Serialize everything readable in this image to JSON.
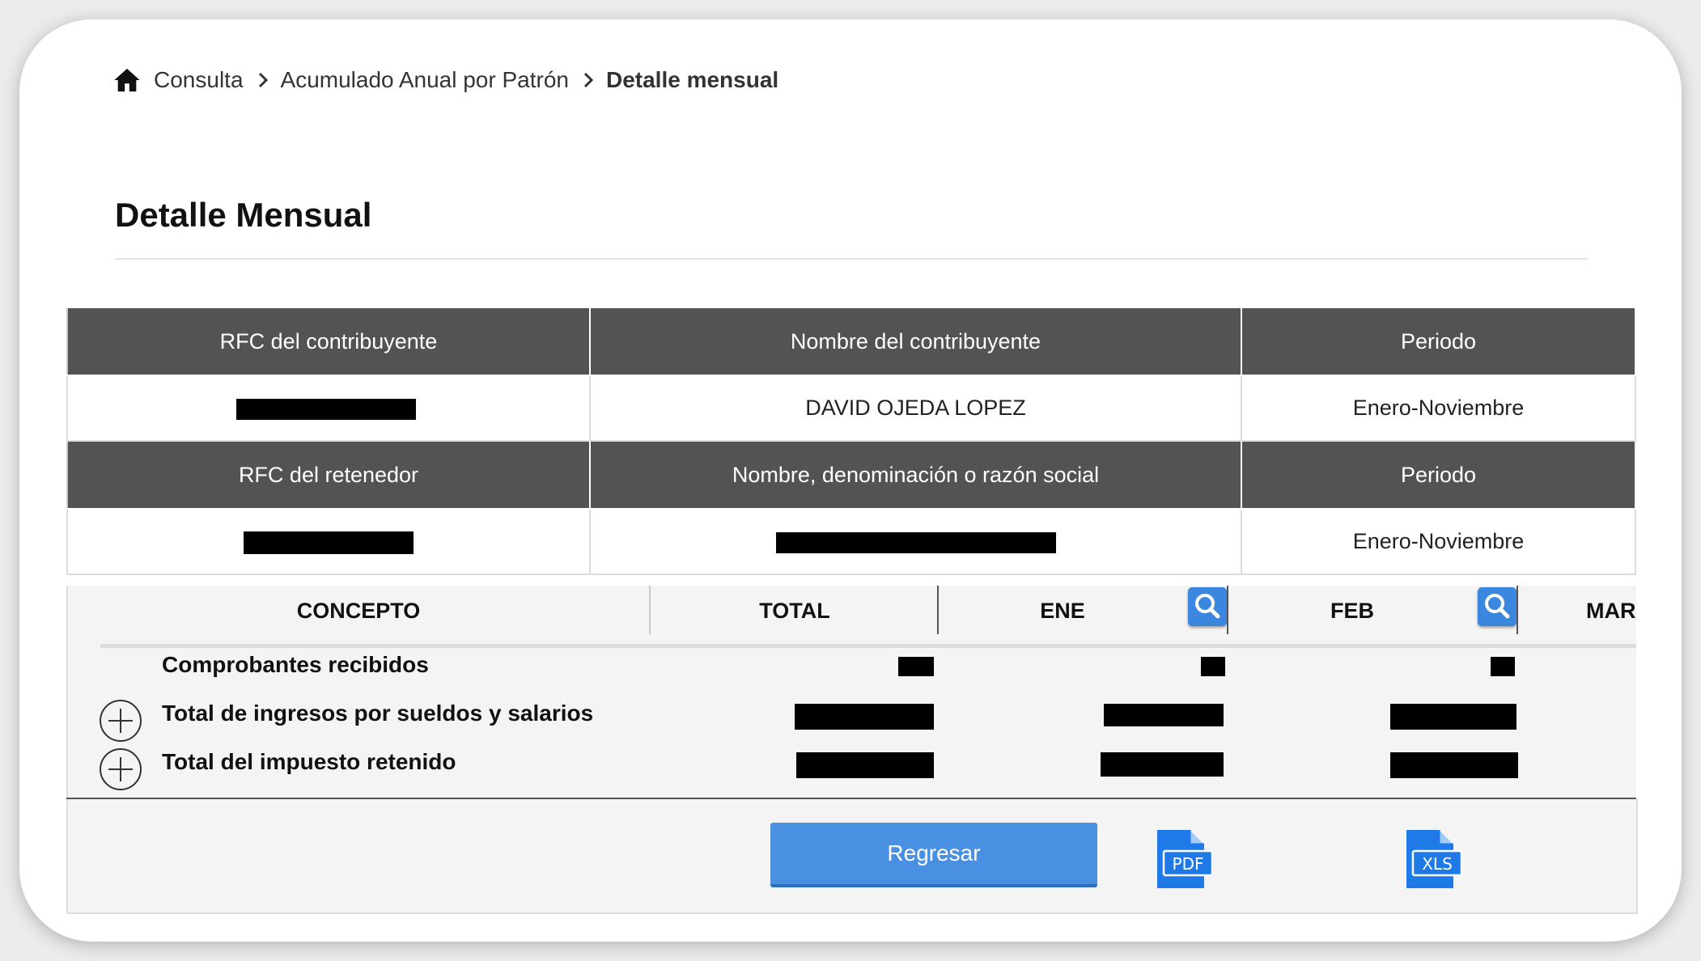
{
  "breadcrumb": {
    "items": [
      "Consulta",
      "Acumulado Anual por Patrón"
    ],
    "current": "Detalle mensual"
  },
  "page_title": "Detalle Mensual",
  "info_table": {
    "header1": [
      "RFC del contribuyente",
      "Nombre del contribuyente",
      "Periodo"
    ],
    "row1": {
      "nombre": "DAVID OJEDA LOPEZ",
      "periodo": "Enero-Noviembre"
    },
    "header2": [
      "RFC del retenedor",
      "Nombre, denominación o razón social",
      "Periodo"
    ],
    "row2": {
      "periodo": "Enero-Noviembre"
    }
  },
  "concept_table": {
    "columns": [
      "CONCEPTO",
      "TOTAL",
      "ENE",
      "FEB",
      "MAR"
    ],
    "rows": [
      "Comprobantes recibidos",
      "Total de ingresos por sueldos y salarios",
      "Total del impuesto retenido"
    ]
  },
  "footer": {
    "back_label": "Regresar",
    "pdf_label": "PDF",
    "xls_label": "XLS"
  },
  "colors": {
    "header_bg": "#535353",
    "accent": "#3b86de",
    "button": "#4a90e2"
  },
  "icons": [
    "home-icon",
    "chevron-right-icon",
    "search-icon",
    "plus-circle-icon",
    "pdf-file-icon",
    "xls-file-icon"
  ]
}
